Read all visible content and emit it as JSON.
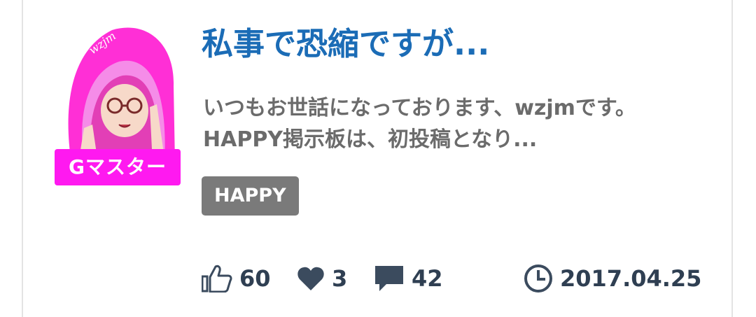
{
  "post": {
    "title": "私事で恐縮ですが...",
    "excerpt": "いつもお世話になっております、wzjmです。 HAPPY掲示板は、初投稿となり...",
    "tag": "HAPPY"
  },
  "author": {
    "rank_badge": "Gマスター",
    "avatar_text": "wzjm"
  },
  "stats": {
    "likes": "60",
    "hearts": "3",
    "comments": "42",
    "date": "2017.04.25"
  },
  "icons": {
    "like": "thumbs-up-icon",
    "heart": "heart-icon",
    "comment": "comment-icon",
    "clock": "clock-icon"
  },
  "colors": {
    "title": "#1b6cb6",
    "badge": "#ff19f0",
    "tag": "#7a7a7a",
    "stat_text": "#2f3f52"
  }
}
